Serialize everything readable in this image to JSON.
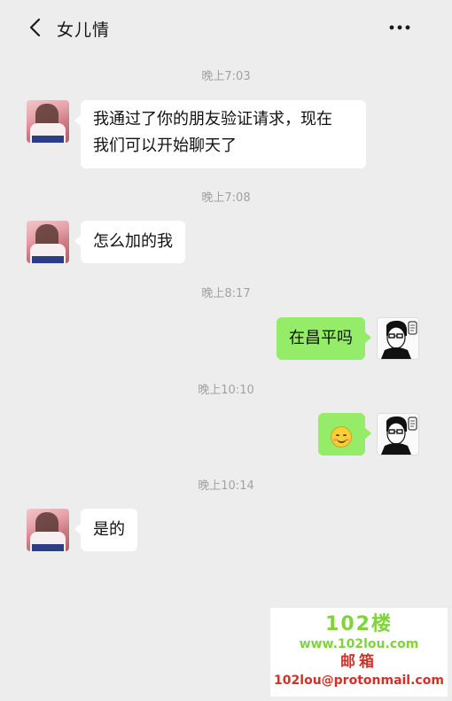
{
  "header": {
    "title": "女儿情",
    "back_icon": "chevron-left-icon",
    "more_icon": "more-dots-icon"
  },
  "messages": [
    {
      "time": "晚上7:03",
      "sender": "contact",
      "text_line1": "我通过了你的朋友验证请求，现在",
      "text_line2": "我们可以开始聊天了"
    },
    {
      "time": "晚上7:08",
      "sender": "contact",
      "text": "怎么加的我"
    },
    {
      "time": "晚上8:17",
      "sender": "me",
      "text": "在昌平吗"
    },
    {
      "time": "晚上10:10",
      "sender": "me",
      "emoji": "smile-emoji-icon"
    },
    {
      "time": "晚上10:14",
      "sender": "contact",
      "text": "是的"
    }
  ],
  "colors": {
    "background": "#ededed",
    "bubble_me": "#95ec69",
    "bubble_contact": "#ffffff",
    "timestamp": "#a2a2a2"
  },
  "watermark": {
    "logo": "102楼",
    "site": "www.102lou.com",
    "mail_label": "邮箱",
    "email": "102lou@protonmail.com"
  }
}
